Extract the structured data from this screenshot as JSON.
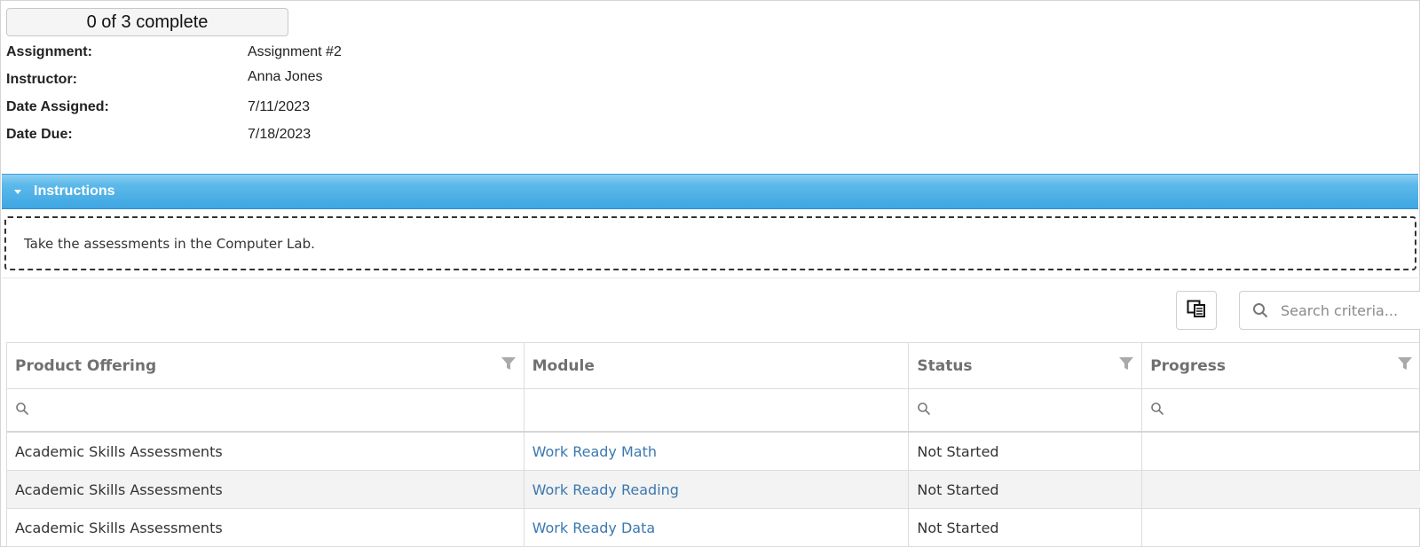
{
  "progress": {
    "label": "0 of 3 complete"
  },
  "assignment_info": {
    "assignment_label": "Assignment:",
    "assignment_value": "Assignment #2",
    "instructor_label": "Instructor:",
    "instructor_value": "Anna Jones",
    "date_assigned_label": "Date Assigned:",
    "date_assigned_value": "7/11/2023",
    "date_due_label": "Date Due:",
    "date_due_value": "7/18/2023"
  },
  "instructions": {
    "title": "Instructions",
    "text": "Take the assessments in the Computer Lab."
  },
  "toolbar": {
    "export_icon": "column-chooser-icon",
    "search_placeholder": "Search criteria...",
    "search_value": ""
  },
  "grid": {
    "columns": [
      "Product Offering",
      "Module",
      "Status",
      "Progress"
    ],
    "rows": [
      {
        "product_offering": "Academic Skills Assessments",
        "module": "Work Ready Math",
        "status": "Not Started",
        "progress": ""
      },
      {
        "product_offering": "Academic Skills Assessments",
        "module": "Work Ready Reading",
        "status": "Not Started",
        "progress": ""
      },
      {
        "product_offering": "Academic Skills Assessments",
        "module": "Work Ready Data",
        "status": "Not Started",
        "progress": ""
      }
    ]
  },
  "colors": {
    "instructions_bar": "#3ea6e2",
    "link": "#3b78b0",
    "header_text": "#707070",
    "alt_row": "#f3f3f3"
  }
}
